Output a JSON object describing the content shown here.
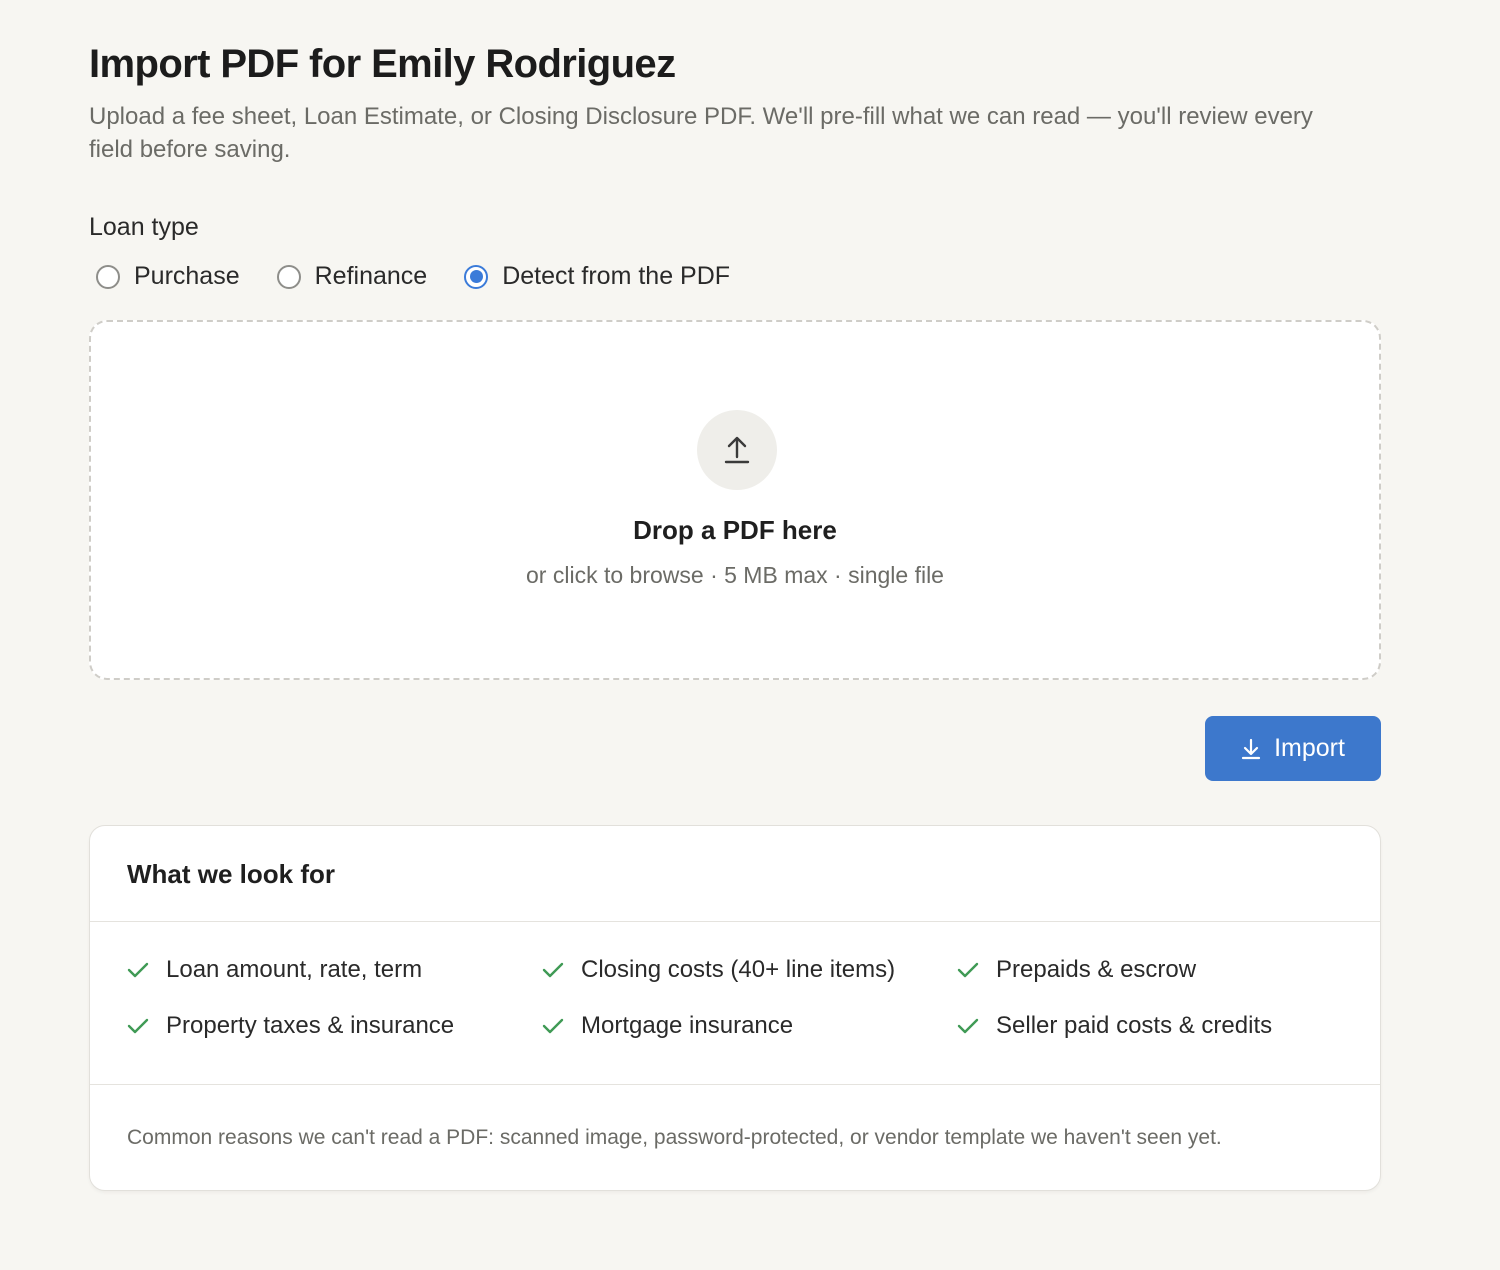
{
  "header": {
    "title": "Import PDF for Emily Rodriguez",
    "subtitle": "Upload a fee sheet, Loan Estimate, or Closing Disclosure PDF. We'll pre-fill what we can read — you'll review every field before saving."
  },
  "loan_type": {
    "label": "Loan type",
    "options": [
      {
        "label": "Purchase",
        "checked": false
      },
      {
        "label": "Refinance",
        "checked": false
      },
      {
        "label": "Detect from the PDF",
        "checked": true
      }
    ]
  },
  "dropzone": {
    "icon": "upload-icon",
    "title": "Drop a PDF here",
    "hint": "or click to browse · 5 MB max · single file"
  },
  "import_button": {
    "label": "Import",
    "icon": "download-icon",
    "color": "#3d78cc"
  },
  "info_card": {
    "title": "What we look for",
    "items": [
      "Loan amount, rate, term",
      "Closing costs (40+ line items)",
      "Prepaids & escrow",
      "Property taxes & insurance",
      "Mortgage insurance",
      "Seller paid costs & credits"
    ],
    "item_icon": "check-icon",
    "check_color": "#3f9a55",
    "footnote": "Common reasons we can't read a PDF: scanned image, password-protected, or vendor template we haven't seen yet."
  },
  "colors": {
    "background": "#f7f6f2",
    "accent": "#3b7bd9"
  }
}
